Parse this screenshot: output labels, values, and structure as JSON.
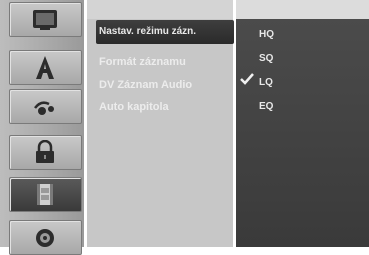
{
  "icons": [
    {
      "name": "tv-icon"
    },
    {
      "name": "letter-a-icon"
    },
    {
      "name": "sound-icon"
    },
    {
      "name": "lock-icon"
    },
    {
      "name": "film-icon"
    },
    {
      "name": "disc-icon"
    }
  ],
  "menu": {
    "items": [
      {
        "label": "Nastav. režimu zázn."
      },
      {
        "label": "Formát záznamu"
      },
      {
        "label": "DV Záznam Audio"
      },
      {
        "label": "Auto kapitola"
      }
    ]
  },
  "options": {
    "items": [
      {
        "label": "HQ",
        "selected": false
      },
      {
        "label": "SQ",
        "selected": true
      },
      {
        "label": "LQ",
        "selected": false
      },
      {
        "label": "EQ",
        "selected": false
      }
    ]
  }
}
